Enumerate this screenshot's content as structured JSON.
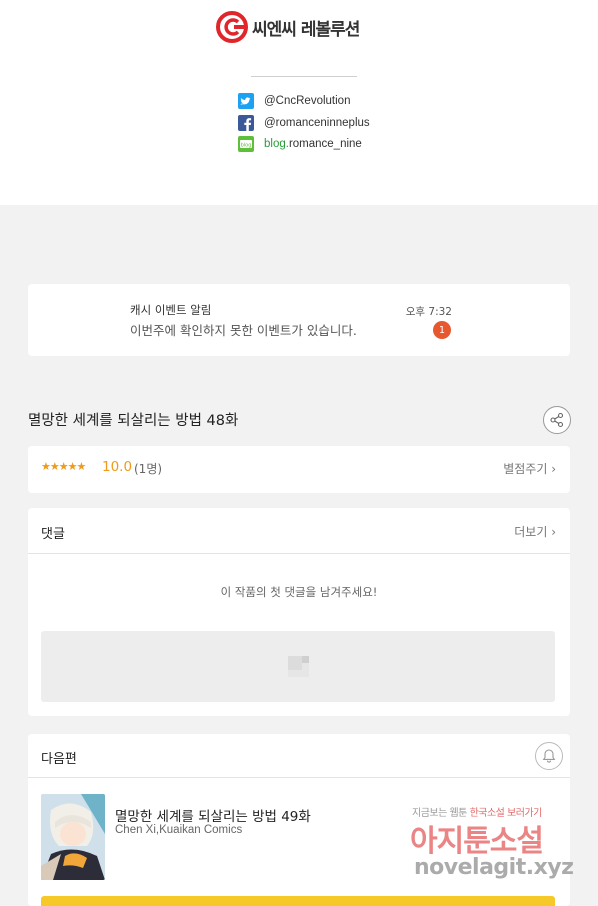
{
  "credits": {
    "logo_text": "씨엔씨 레볼루션",
    "social": [
      {
        "icon": "twitter-icon",
        "text": "@CncRevolution"
      },
      {
        "icon": "facebook-icon",
        "text": "@romanceninneplus"
      },
      {
        "icon": "blog-icon",
        "text_prefix": "blog.",
        "text": "romance_nine"
      }
    ]
  },
  "notification": {
    "title": "캐시 이벤트 알림",
    "message": "이번주에 확인하지 못한 이벤트가 있습니다.",
    "time": "오후 7:32",
    "badge": "1"
  },
  "episode": {
    "title": "멸망한 세계를 되살리는 방법 48화"
  },
  "rating": {
    "stars": "★★★★★",
    "score": "10.0",
    "count": "(1명)",
    "rate_link": "별점주기 ›"
  },
  "comments": {
    "title": "댓글",
    "more": "더보기 ›",
    "empty_message": "이 작품의 첫 댓글을 남겨주세요!"
  },
  "next_episode": {
    "header": "다음편",
    "title": "멸망한 세계를 되살리는 방법 49화",
    "authors": "Chen Xi,Kuaikan Comics"
  },
  "watermark": {
    "line1_a": "지금보는 웹툰 ",
    "line1_b": "한국소설 보러가기",
    "line2": "아지툰소설",
    "line3": "novelagit.xyz"
  },
  "colors": {
    "accent_orange": "#f09a17",
    "badge_red": "#e8582e",
    "cta_yellow": "#f6c928",
    "logo_red": "#e0262b"
  }
}
